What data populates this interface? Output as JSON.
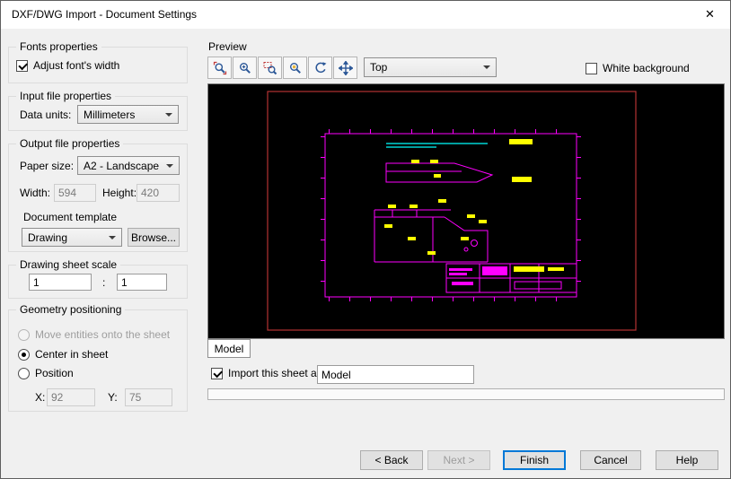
{
  "window": {
    "title": "DXF/DWG Import - Document Settings",
    "close_icon": "✕"
  },
  "left_panel": {
    "fonts": {
      "title": "Fonts properties",
      "adjust_fonts_width_label": "Adjust font's width",
      "adjust_fonts_width_checked": true
    },
    "input_file": {
      "title": "Input file properties",
      "data_units_label": "Data units:",
      "data_units_value": "Millimeters"
    },
    "output_file": {
      "title": "Output file properties",
      "paper_size_label": "Paper size:",
      "paper_size_value": "A2 - Landscape",
      "width_label": "Width:",
      "width_value": "594",
      "height_label": "Height:",
      "height_value": "420",
      "document_template_label": "Document template",
      "template_value": "Drawing",
      "browse_label": "Browse..."
    },
    "sheet_scale": {
      "title": "Drawing sheet scale",
      "numerator": "1",
      "separator": ":",
      "denominator": "1"
    },
    "geometry": {
      "title": "Geometry positioning",
      "options": [
        {
          "label": "Move entities onto the sheet",
          "state": "disabled"
        },
        {
          "label": "Center in sheet",
          "state": "selected"
        },
        {
          "label": "Position",
          "state": "normal"
        }
      ],
      "x_label": "X:",
      "x_value": "92",
      "y_label": "Y:",
      "y_value": "75"
    }
  },
  "preview": {
    "title": "Preview",
    "toolbar_icons": [
      "zoom-fit",
      "zoom-in-out",
      "zoom-area",
      "zoom-selected",
      "rotate-view",
      "pan"
    ],
    "view_selector_value": "Top",
    "white_background_label": "White background",
    "white_background_checked": false,
    "sheet_tab_label": "Model",
    "import_sheet_label": "Import this sheet as :",
    "import_sheet_checked": true,
    "sheet_name_value": "Model",
    "colors": {
      "canvas_bg": "#000000",
      "sheet_border": "#b43333",
      "frame": "#ff00ff",
      "lines_cyan": "#00ffff",
      "highlight": "#ffff00"
    }
  },
  "footer": {
    "back_label": "< Back",
    "next_label": "Next >",
    "finish_label": "Finish",
    "cancel_label": "Cancel",
    "help_label": "Help"
  }
}
